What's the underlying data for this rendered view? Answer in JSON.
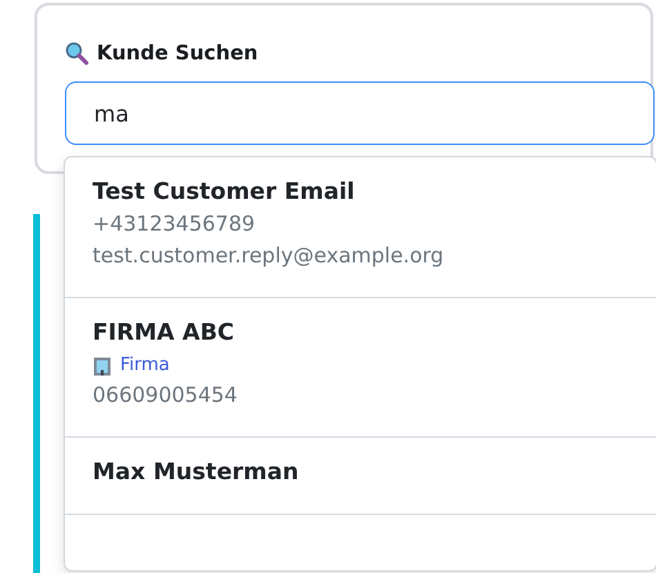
{
  "search": {
    "label": "Kunde Suchen",
    "value": "ma"
  },
  "results": [
    {
      "name": "Test Customer Email",
      "phone": "+43123456789",
      "email": "test.customer.reply@example.org"
    },
    {
      "name": "FIRMA ABC",
      "company_tag": "Firma",
      "phone": "06609005454"
    },
    {
      "name": "Max Musterman"
    }
  ]
}
